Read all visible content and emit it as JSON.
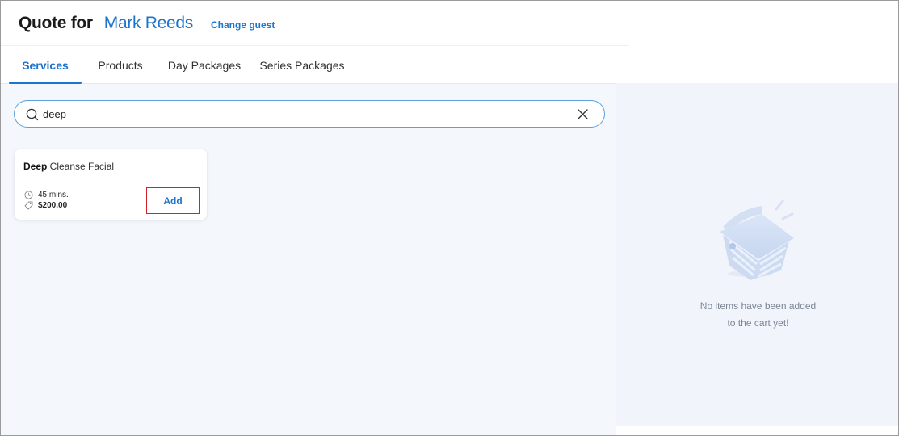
{
  "header": {
    "quote_label": "Quote for",
    "guest_name": "Mark Reeds",
    "change_guest": "Change guest"
  },
  "tabs": [
    {
      "label": "Services",
      "active": true
    },
    {
      "label": "Products",
      "active": false
    },
    {
      "label": "Day Packages",
      "active": false
    },
    {
      "label": "Series Packages",
      "active": false
    }
  ],
  "search": {
    "value": "deep",
    "icon": "search-icon",
    "clear_icon": "close-icon"
  },
  "results": [
    {
      "title_match": "Deep",
      "title_rest": " Cleanse Facial",
      "duration": "45 mins.",
      "price": "$200.00",
      "add_label": "Add"
    }
  ],
  "cart": {
    "empty_line1": "No items have been added",
    "empty_line2": "to the cart yet!"
  },
  "colors": {
    "accent": "#1c74cc",
    "highlight_border": "#d8202b",
    "cart_bg": "#f1f5fb"
  }
}
